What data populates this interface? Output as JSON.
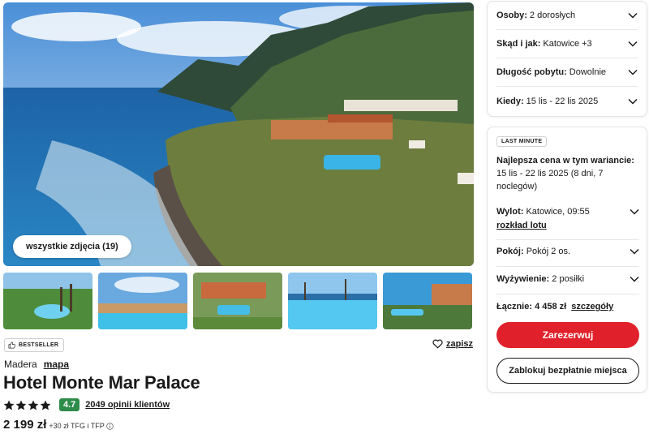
{
  "gallery": {
    "all_photos_label": "wszystkie zdjęcia (19)",
    "thumbnails": [
      "photo-1",
      "photo-2",
      "photo-3",
      "photo-4",
      "photo-5"
    ]
  },
  "hotel": {
    "badge": "BESTSELLER",
    "save_label": "zapisz",
    "region": "Madera",
    "map_link": "mapa",
    "name": "Hotel Monte Mar Palace",
    "stars": 4,
    "score": "4.7",
    "reviews": "2049 opinii klientów",
    "price": "2 199 zł",
    "price_extra": "+30 zł TFG i TFP"
  },
  "search": {
    "persons_label": "Osoby:",
    "persons_value": "2 dorosłych",
    "from_label": "Skąd i jak:",
    "from_value": "Katowice +3",
    "length_label": "Długość pobytu:",
    "length_value": "Dowolnie",
    "when_label": "Kiedy:",
    "when_value": "15 lis - 22 lis 2025"
  },
  "offer": {
    "tag": "LAST MINUTE",
    "best_title": "Najlepsza cena w tym wariancie:",
    "best_value": "15 lis - 22 lis 2025 (8 dni, 7 noclegów)",
    "departure_label": "Wylot:",
    "departure_value": "Katowice, 09:55",
    "schedule_link": "rozkład lotu",
    "room_label": "Pokój:",
    "room_value": "Pokój 2 os.",
    "food_label": "Wyżywienie:",
    "food_value": "2 posiłki",
    "total_label": "Łącznie: 4 458 zł",
    "details_link": "szczegóły",
    "reserve_button": "Zarezerwuj",
    "block_button": "Zablokuj bezpłatnie miejsca"
  },
  "colors": {
    "accent": "#e0202a",
    "score_bg": "#2e8c4a"
  }
}
